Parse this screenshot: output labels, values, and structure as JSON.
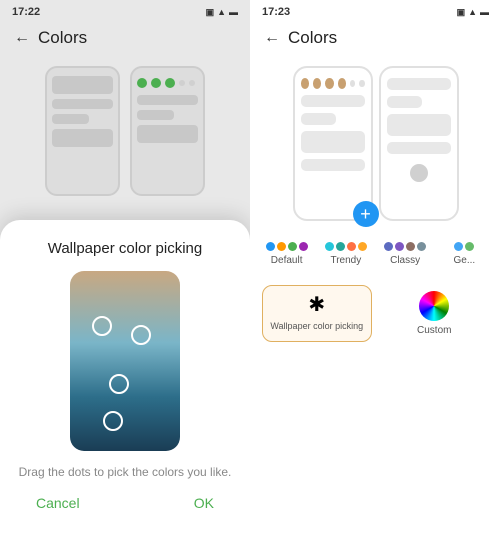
{
  "left": {
    "time": "17:22",
    "title": "Colors",
    "modal": {
      "title": "Wallpaper color picking",
      "hint": "Drag the dots to pick the colors you like.",
      "cancel": "Cancel",
      "ok": "OK"
    },
    "preview_dots": [
      {
        "color": "#4CAF50"
      },
      {
        "color": "#4CAF50"
      },
      {
        "color": "#4CAF50"
      }
    ]
  },
  "right": {
    "time": "17:23",
    "title": "Colors",
    "color_options": [
      {
        "id": "default",
        "label": "Default",
        "dots": [
          "#2196F3",
          "#FF9800",
          "#4CAF50",
          "#9C27B0"
        ]
      },
      {
        "id": "trendy",
        "label": "Trendy",
        "dots": [
          "#26C6DA",
          "#26A69A",
          "#FF7043",
          "#FFA726"
        ]
      },
      {
        "id": "classy",
        "label": "Classy",
        "dots": [
          "#5C6BC0",
          "#7E57C2",
          "#8D6E63",
          "#78909C"
        ]
      },
      {
        "id": "ge",
        "label": "Ge...",
        "dots": [
          "#42A5F5",
          "#66BB6A"
        ]
      }
    ],
    "bottom_options": {
      "wallpaper": "Wallpaper color picking",
      "custom": "Custom"
    },
    "preview_dots_right": [
      {
        "color": "#c8a070"
      },
      {
        "color": "#c8a070"
      },
      {
        "color": "#c8a070"
      },
      {
        "color": "#c8a070"
      }
    ]
  }
}
